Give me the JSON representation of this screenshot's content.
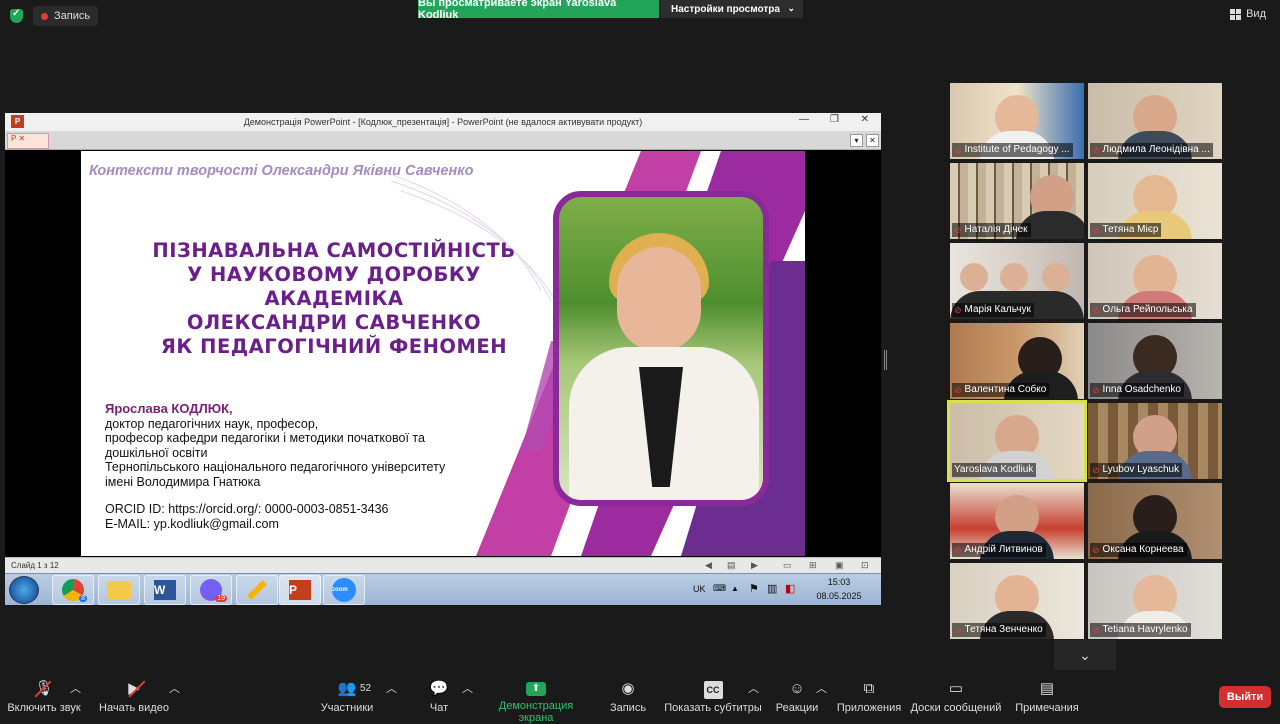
{
  "top": {
    "recording_label": "Запись",
    "share_banner": "Вы просматриваете экран Yaroslava Kodliuk",
    "view_settings": "Настройки просмотра",
    "view_label": "Вид"
  },
  "ppt": {
    "window_title": "Демонстрація PowerPoint - [Кодлюк_презентація] - PowerPoint (не вдалося активувати продукт)",
    "slide_counter": "Слайд 1 з 12"
  },
  "slide": {
    "heading": "Контексти творчості Олександри Яківни Савченко",
    "title_lines": [
      "ПІЗНАВАЛЬНА САМОСТІЙНІСТЬ",
      "У НАУКОВОМУ ДОРОБКУ",
      "АКАДЕМІКА",
      "ОЛЕКСАНДРИ САВЧЕНКО",
      "ЯК ПЕДАГОГІЧНИЙ ФЕНОМЕН"
    ],
    "author_name": "Ярослава КОДЛЮК,",
    "author_lines": [
      "доктор педагогічних наук, професор,",
      "професор кафедри педагогіки і методики початкової та",
      "дошкільної освіти",
      "Тернопільського національного педагогічного університету",
      "імені Володимира Гнатюка"
    ],
    "orcid": "ORCID ID: https://orcid.org/: 0000-0003-0851-3436",
    "email": "E-MAIL: yp.kodliuk@gmail.com"
  },
  "taskbar": {
    "lang": "UK",
    "time": "15:03",
    "date": "08.05.2025",
    "chrome_badge": "8",
    "viber_badge": "19",
    "zoom_label": "zoom"
  },
  "participants": [
    {
      "name": "Institute of Pedagogy ..."
    },
    {
      "name": "Людмила Леонідівна ..."
    },
    {
      "name": "Наталія Дічек"
    },
    {
      "name": "Тетяна Мієр"
    },
    {
      "name": "Марія Кальчук"
    },
    {
      "name": "Ольга Рейпольська"
    },
    {
      "name": "Валентина Собко"
    },
    {
      "name": "Inna Osadchenko"
    },
    {
      "name": "Yaroslava Kodliuk"
    },
    {
      "name": "Lyubov Lyaschuk"
    },
    {
      "name": "Андрій Литвинов"
    },
    {
      "name": "Оксана Корнеева"
    },
    {
      "name": "Тетяна Зенченко"
    },
    {
      "name": "Tetiana Havrylenko"
    }
  ],
  "toolbar": {
    "unmute": "Включить звук",
    "start_video": "Начать видео",
    "participants": "Участники",
    "participants_count": "52",
    "chat": "Чат",
    "share": "Демонстрация экрана",
    "record": "Запись",
    "captions": "Показать субтитры",
    "reactions": "Реакции",
    "apps": "Приложения",
    "whiteboards": "Доски сообщений",
    "notes": "Примечания",
    "leave": "Выйти"
  }
}
